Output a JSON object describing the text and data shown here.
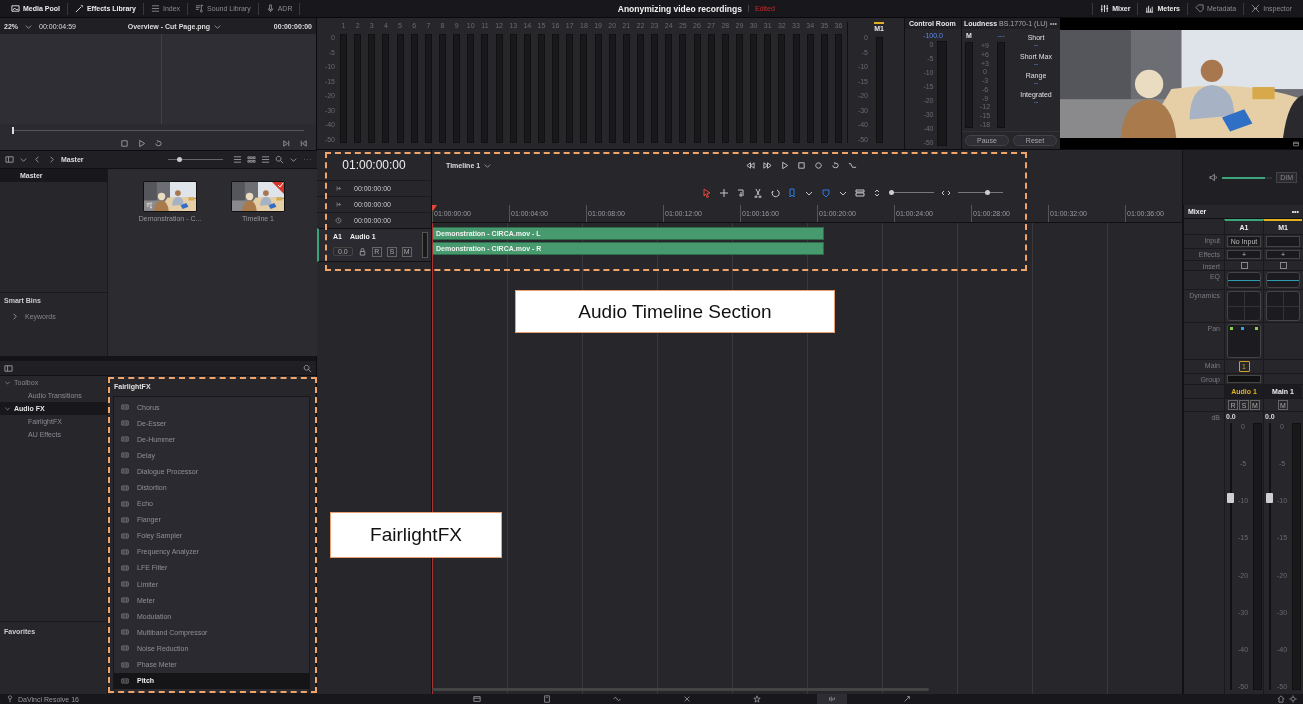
{
  "header": {
    "left_tabs": [
      {
        "label": "Media Pool",
        "selected": true
      },
      {
        "label": "Effects Library",
        "selected": true
      },
      {
        "label": "Index",
        "selected": false
      },
      {
        "label": "Sound Library",
        "selected": false
      },
      {
        "label": "ADR",
        "selected": false
      }
    ],
    "project_title": "Anonymizing video recordings",
    "project_status": "Edited",
    "right_tabs": [
      {
        "label": "Mixer",
        "selected": true
      },
      {
        "label": "Meters",
        "selected": true
      },
      {
        "label": "Metadata",
        "selected": false
      },
      {
        "label": "Inspector",
        "selected": false
      }
    ]
  },
  "viewer": {
    "zoom": "22%",
    "duration": "00:00:04:59",
    "clip_name": "Overview - Cut Page.png",
    "timecode": "00:00:00:00",
    "scrub": {
      "level": 0
    }
  },
  "meters": {
    "channels": [
      "1",
      "2",
      "3",
      "4",
      "5",
      "6",
      "7",
      "8",
      "9",
      "10",
      "11",
      "12",
      "13",
      "14",
      "15",
      "16",
      "17",
      "18",
      "19",
      "20",
      "21",
      "22",
      "23",
      "24",
      "25",
      "26",
      "27",
      "28",
      "29",
      "30",
      "31",
      "32",
      "33",
      "34",
      "35",
      "36"
    ],
    "scale": [
      "0",
      "-5",
      "-10",
      "-15",
      "-20",
      "-30",
      "-40",
      "-50"
    ],
    "master": {
      "label": "M1",
      "scale": [
        "0",
        "-5",
        "-10",
        "-15",
        "-20",
        "-30",
        "-40",
        "-50"
      ]
    }
  },
  "control_room": {
    "title": "Control Room",
    "reading": "-100.0",
    "scale": [
      "0",
      "-5",
      "-10",
      "-15",
      "-20",
      "-30",
      "-40",
      "-50"
    ]
  },
  "loudness": {
    "title": "Loudness",
    "standard": "BS.1770-1 (LU)",
    "more": "•••",
    "meter_label": "M",
    "meter_reading": "---",
    "scale": [
      "+9",
      "+6",
      "+3",
      "0",
      "-3",
      "-6",
      "-9",
      "-12",
      "-15",
      "-18"
    ],
    "stats": [
      {
        "label": "Short",
        "value": "--"
      },
      {
        "label": "Short Max",
        "value": "--"
      },
      {
        "label": "Range",
        "value": "--"
      },
      {
        "label": "Integrated",
        "value": "--"
      }
    ],
    "buttons": [
      "Pause",
      "Reset"
    ]
  },
  "media_pool": {
    "bin_path": "Master",
    "bins": [
      {
        "label": "Master",
        "selected": true
      }
    ],
    "clips": [
      {
        "name": "Demonstration - C...",
        "kind": "clip"
      },
      {
        "name": "Timeline 1",
        "kind": "timeline"
      }
    ],
    "smart_bins_title": "Smart Bins",
    "smart_bins": [
      {
        "label": "Keywords",
        "expanded": false
      }
    ],
    "zoom_slider": {
      "level": 0.2
    }
  },
  "timeline": {
    "timecode": "01:00:00:00",
    "timecodes": [
      "00:00:00:00",
      "00:00:00:00",
      "00:00:00:00"
    ],
    "name": "Timeline 1",
    "ruler": [
      "01:00:00:00",
      "01:00:04:00",
      "01:00:08:00",
      "01:00:12:00",
      "01:00:16:00",
      "01:00:20:00",
      "01:00:24:00",
      "01:00:28:00",
      "01:00:32:00",
      "01:00:36:00"
    ],
    "tracks": [
      {
        "id": "A1",
        "name": "Audio 1",
        "volume": "0.0",
        "buttons": [
          "R",
          "S",
          "M"
        ],
        "clips": [
          "Demonstration - CIRCA.mov - L",
          "Demonstration - CIRCA.mov - R"
        ]
      }
    ],
    "monitor_volume": {
      "level": 0.85
    },
    "height_slider": {
      "level": 0.05
    },
    "zoom_slider": {
      "level": 0.65
    },
    "dim_button": "DIM"
  },
  "effects_library": {
    "tree": [
      {
        "label": "Toolbox",
        "expanded": true,
        "selected": false,
        "children": [
          {
            "label": "Audio Transitions",
            "selected": false
          }
        ]
      },
      {
        "label": "Audio FX",
        "expanded": true,
        "selected": true,
        "children": [
          {
            "label": "FairlightFX",
            "selected": false
          },
          {
            "label": "AU Effects",
            "selected": false
          }
        ]
      }
    ],
    "favorites_title": "Favorites",
    "list_title": "FairlightFX",
    "effects": [
      {
        "label": "Chorus",
        "selected": false
      },
      {
        "label": "De-Esser",
        "selected": false
      },
      {
        "label": "De-Hummer",
        "selected": false
      },
      {
        "label": "Delay",
        "selected": false
      },
      {
        "label": "Dialogue Processor",
        "selected": false
      },
      {
        "label": "Distortion",
        "selected": false
      },
      {
        "label": "Echo",
        "selected": false
      },
      {
        "label": "Flanger",
        "selected": false
      },
      {
        "label": "Foley Sampler",
        "selected": false
      },
      {
        "label": "Frequency Analyzer",
        "selected": false
      },
      {
        "label": "LFE Filter",
        "selected": false
      },
      {
        "label": "Limiter",
        "selected": false
      },
      {
        "label": "Meter",
        "selected": false
      },
      {
        "label": "Modulation",
        "selected": false
      },
      {
        "label": "Multiband Compressor",
        "selected": false
      },
      {
        "label": "Noise Reduction",
        "selected": false
      },
      {
        "label": "Phase Meter",
        "selected": false
      },
      {
        "label": "Pitch",
        "selected": true
      }
    ]
  },
  "mixer": {
    "title": "Mixer",
    "more": "•••",
    "row_labels": [
      "Input",
      "Effects",
      "Insert",
      "EQ",
      "Dynamics",
      "Pan",
      "Main",
      "Group",
      "dB"
    ],
    "channels": [
      {
        "id": "A1",
        "color": "#3aa57a",
        "selected": true,
        "input": "No Input",
        "effects": "+",
        "main": "1",
        "name": "Audio 1",
        "buttons": [
          "R",
          "S",
          "M"
        ],
        "gain": "0.0",
        "level": 0.72,
        "pan": true,
        "scale": [
          "0",
          "-5",
          "-10",
          "-15",
          "-20",
          "-30",
          "-40",
          "-50"
        ]
      },
      {
        "id": "M1",
        "color": "#e0b020",
        "selected": false,
        "effects": "+",
        "name": "Main 1",
        "buttons": [
          "M"
        ],
        "gain": "0.0",
        "level": 0.72,
        "pan": false,
        "scale": [
          "0",
          "-5",
          "-10",
          "-15",
          "-20",
          "-30",
          "-40",
          "-50"
        ]
      }
    ]
  },
  "status_bar": {
    "app_name": "DaVinci Resolve 16",
    "pages": [
      {
        "selected": false
      },
      {
        "selected": false
      },
      {
        "selected": false
      },
      {
        "selected": false
      },
      {
        "selected": false
      },
      {
        "selected": true
      },
      {
        "selected": false
      }
    ]
  },
  "annotations": [
    {
      "label": "Audio Timeline Section"
    },
    {
      "label": "FairlightFX"
    }
  ]
}
